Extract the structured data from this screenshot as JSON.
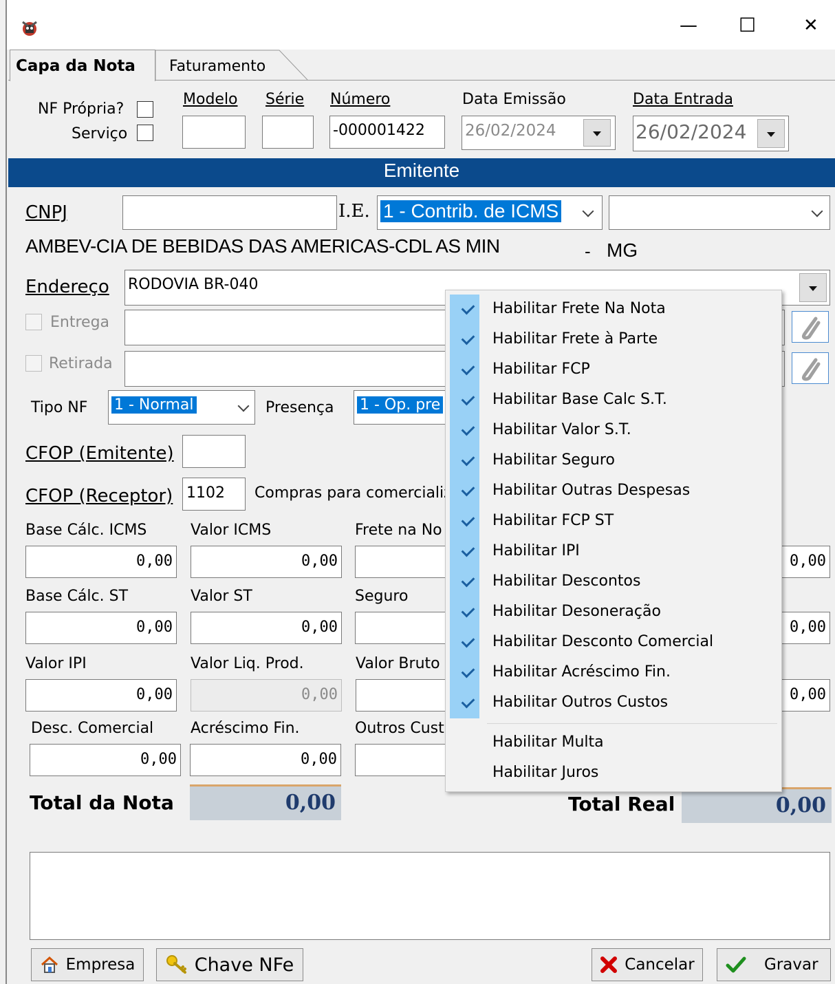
{
  "window": {
    "controls": {
      "minimize": "—",
      "maximize": "☐",
      "close": "✕"
    }
  },
  "tabs": [
    {
      "label": "Capa da Nota",
      "active": true
    },
    {
      "label": "Faturamento",
      "active": false
    }
  ],
  "header": {
    "nf_propria_label": "NF Própria?",
    "servico_label": "Serviço",
    "modelo_label": "Modelo",
    "serie_label": "Série",
    "numero_label": "Número",
    "numero_value": "-000001422",
    "data_emissao_label": "Data Emissão",
    "data_emissao_value": "26/02/2024",
    "data_entrada_label": "Data Entrada",
    "data_entrada_value": "26/02/2024"
  },
  "section_title": "Emitente",
  "emitente": {
    "cnpj_label": "CNPJ",
    "ie_label": "I.E.",
    "ie_value": "1 - Contrib. de ICMS",
    "name": "AMBEV-CIA DE BEBIDAS DAS AMERICAS-CDL AS MIN",
    "uf_separator": "-",
    "uf": "MG",
    "endereco_label": "Endereço",
    "endereco_value": "RODOVIA BR-040",
    "entrega_label": "Entrega",
    "retirada_label": "Retirada",
    "tipo_nf_label": "Tipo NF",
    "tipo_nf_value": "1 - Normal",
    "presenca_label": "Presença",
    "presenca_value": "1 - Op. pre",
    "cfop_emitente_label": "CFOP (Emitente)",
    "cfop_receptor_label": "CFOP (Receptor)",
    "cfop_receptor_value": "1102",
    "cfop_receptor_desc": "Compras para comercializa"
  },
  "values": {
    "base_calc_icms_label": "Base Cálc. ICMS",
    "base_calc_icms": "0,00",
    "valor_icms_label": "Valor ICMS",
    "valor_icms": "0,00",
    "frete_label": "Frete na No",
    "right_col_1": "0,00",
    "base_calc_st_label": "Base Cálc. ST",
    "base_calc_st": "0,00",
    "valor_st_label": "Valor ST",
    "valor_st": "0,00",
    "seguro_label": "Seguro",
    "right_col_2": "0,00",
    "valor_ipi_label": "Valor IPI",
    "valor_ipi": "0,00",
    "valor_liq_label": "Valor Liq. Prod.",
    "valor_liq": "0,00",
    "valor_bruto_label": "Valor Bruto",
    "right_col_3": "0,00",
    "desc_comercial_label": "Desc. Comercial",
    "desc_comercial": "0,00",
    "acrescimo_label": "Acréscimo Fin.",
    "acrescimo": "0,00",
    "outros_custos_label": "Outros Cust"
  },
  "totals": {
    "total_nota_label": "Total da Nota",
    "total_nota": "0,00",
    "total_real_label": "Total Real",
    "total_real": "0,00"
  },
  "buttons": {
    "empresa": "Empresa",
    "chave_nfe": "Chave NFe",
    "cancelar": "Cancelar",
    "gravar": "Gravar"
  },
  "context_menu": {
    "checked_items": [
      "Habilitar Frete Na Nota",
      "Habilitar Frete à Parte",
      "Habilitar FCP",
      "Habilitar Base Calc S.T.",
      "Habilitar Valor S.T.",
      "Habilitar Seguro",
      "Habilitar Outras Despesas",
      "Habilitar FCP ST",
      "Habilitar IPI",
      "Habilitar Descontos",
      "Habilitar Desoneração",
      "Habilitar Desconto Comercial",
      "Habilitar Acréscimo Fin.",
      "Habilitar Outros Custos"
    ],
    "unchecked_items": [
      "Habilitar Multa",
      "Habilitar Juros"
    ]
  },
  "colors": {
    "section_bar": "#0b4a8c",
    "selection": "#0078d7",
    "menu_check_column": "#99d1f6"
  }
}
